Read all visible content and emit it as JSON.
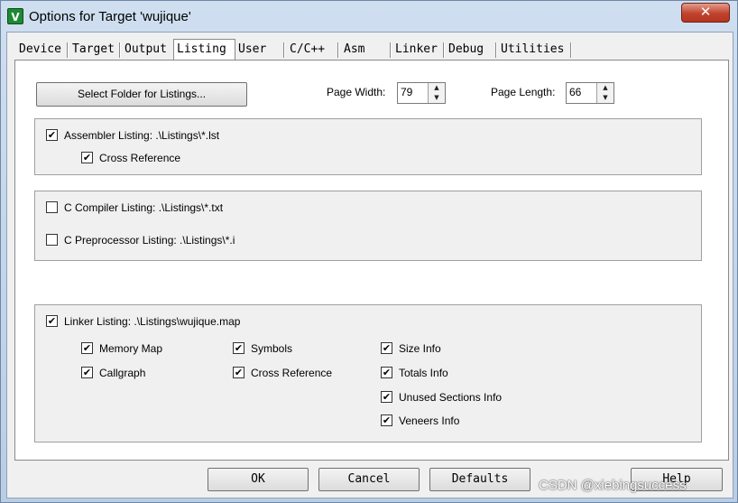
{
  "window": {
    "title": "Options for Target 'wujique'",
    "close_glyph": "✕",
    "app_icon": "V"
  },
  "tabs": [
    "Device",
    "Target",
    "Output",
    "Listing",
    "User",
    "C/C++",
    "Asm",
    "Linker",
    "Debug",
    "Utilities"
  ],
  "active_tab": "Listing",
  "listing": {
    "select_folder_label": "Select Folder for Listings...",
    "page_width_label": "Page Width:",
    "page_width_value": "79",
    "page_length_label": "Page Length:",
    "page_length_value": "66",
    "assembler_label": "Assembler Listing:  .\\Listings\\*.lst",
    "assembler_checked": true,
    "cross_ref_label": "Cross Reference",
    "cross_ref_checked": true,
    "c_compiler_label": "C Compiler Listing:  .\\Listings\\*.txt",
    "c_compiler_checked": false,
    "c_preprocessor_label": "C Preprocessor Listing:  .\\Listings\\*.i",
    "c_preprocessor_checked": false,
    "linker_label": "Linker Listing:  .\\Listings\\wujique.map",
    "linker_checked": true,
    "linker_options": {
      "memory_map": "Memory Map",
      "symbols": "Symbols",
      "size_info": "Size Info",
      "callgraph": "Callgraph",
      "cross_reference": "Cross Reference",
      "totals_info": "Totals Info",
      "unused_sections": "Unused Sections Info",
      "veneers_info": "Veneers Info"
    }
  },
  "footer": {
    "ok": "OK",
    "cancel": "Cancel",
    "defaults": "Defaults",
    "help": "Help"
  },
  "watermark": "CSDN @xiebingsuccess",
  "check_glyph": "✔",
  "spin_up": "▲",
  "spin_down": "▼"
}
